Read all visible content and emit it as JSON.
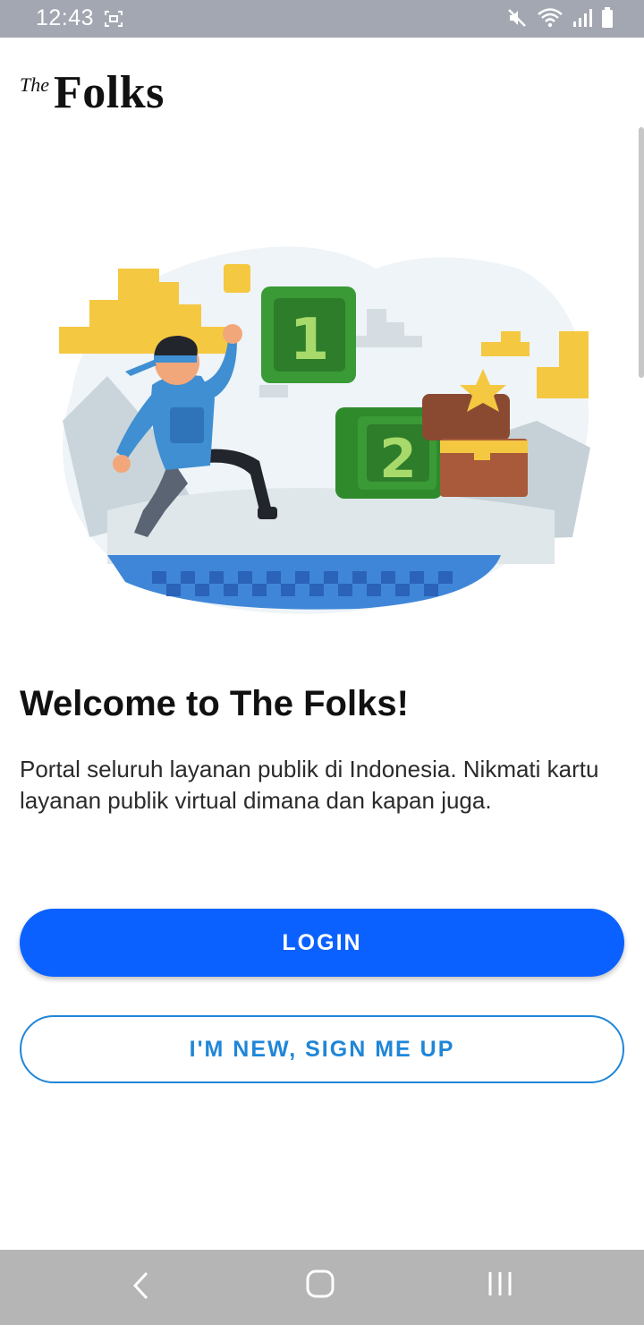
{
  "status_bar": {
    "time": "12:43",
    "icons": [
      "screenshot-icon",
      "mute-icon",
      "wifi-icon",
      "signal-icon",
      "battery-icon"
    ]
  },
  "logo": {
    "the": "The",
    "folks": "Folks"
  },
  "hero": {
    "numbers": [
      "1",
      "2"
    ]
  },
  "welcome": {
    "title": "Welcome to The Folks!",
    "description": "Portal seluruh layanan publik di Indonesia. Nikmati kartu layanan publik virtual dimana dan kapan juga."
  },
  "buttons": {
    "login": "LOGIN",
    "signup": "I'M NEW, SIGN ME UP"
  },
  "colors": {
    "primary": "#0b61ff",
    "outline": "#1f86d8",
    "status_bar": "#a3a7b1",
    "nav_bar": "#b5b5b5"
  },
  "nav_bar": {
    "icons": [
      "back-icon",
      "home-icon",
      "recent-apps-icon"
    ]
  }
}
